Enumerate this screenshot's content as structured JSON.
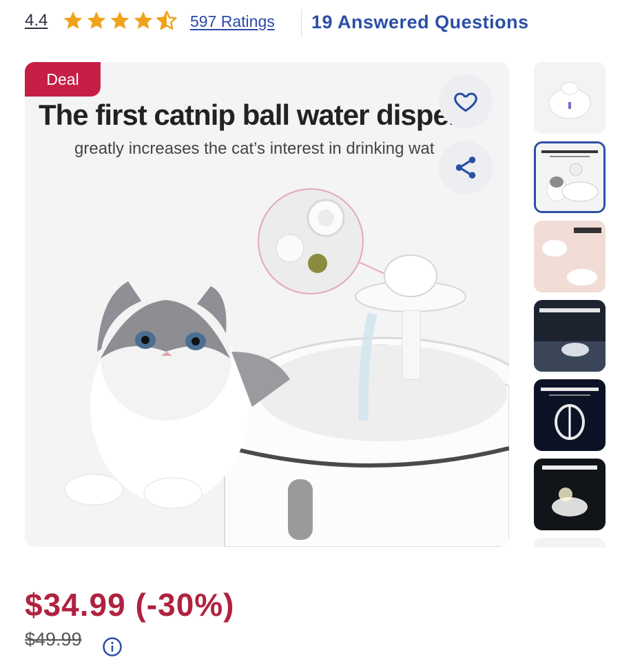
{
  "rating": {
    "score": "4.4",
    "stars_filled": 4.5,
    "ratings_link": "597 Ratings",
    "answered_questions": "19 Answered Questions"
  },
  "badge": {
    "deal": "Deal"
  },
  "image": {
    "heading": "The first catnip ball water dispen",
    "subheading": "greatly increases the cat’s interest in drinking wat"
  },
  "thumbnails": [
    {
      "name": "thumb-fountain-front",
      "caption": ""
    },
    {
      "name": "thumb-catnip-dispenser",
      "caption": "The first catnip ball water dispenser"
    },
    {
      "name": "thumb-water-level",
      "caption": "The water level is adjustable"
    },
    {
      "name": "thumb-silent-pump",
      "caption": "Ultra Silent Water Pump"
    },
    {
      "name": "thumb-uv-component",
      "caption": "Ultraviolet component"
    },
    {
      "name": "thumb-lighting",
      "caption": "Lighting design"
    }
  ],
  "price": {
    "current": "$34.99 (-30%)",
    "original": "$49.99"
  },
  "icons": {
    "star": "star-icon",
    "favorite": "heart-icon",
    "share": "share-icon",
    "info": "info-icon"
  },
  "colors": {
    "star": "#f0a21c",
    "link": "#2b4aa8",
    "deal": "#c61f45",
    "price": "#b0223f",
    "selected": "#2a4fa6"
  }
}
